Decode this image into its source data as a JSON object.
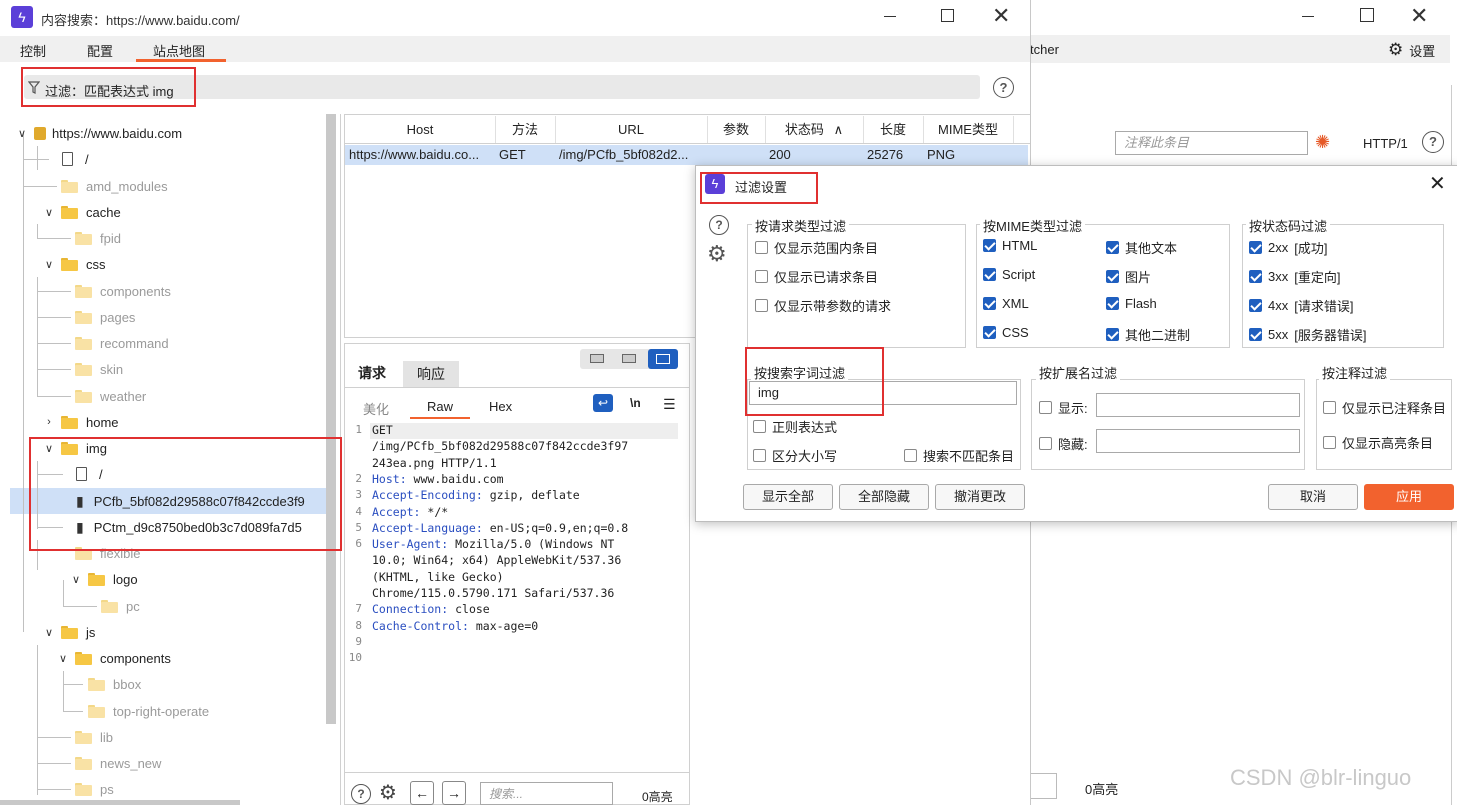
{
  "main_window": {
    "title": "内容搜索：https://www.baidu.com/",
    "tabs": [
      "控制",
      "配置",
      "站点地图"
    ],
    "active_tab": "站点地图",
    "filter_text": "过滤：匹配表达式 img"
  },
  "tree": [
    {
      "label": "https://www.baidu.com",
      "type": "lock"
    },
    {
      "label": "/",
      "type": "file"
    },
    {
      "label": "amd_modules",
      "type": "folder"
    },
    {
      "label": "cache",
      "type": "folder"
    },
    {
      "label": "fpid",
      "type": "folder"
    },
    {
      "label": "css",
      "type": "folder"
    },
    {
      "label": "components",
      "type": "folder"
    },
    {
      "label": "pages",
      "type": "folder"
    },
    {
      "label": "recommand",
      "type": "folder"
    },
    {
      "label": "skin",
      "type": "folder"
    },
    {
      "label": "weather",
      "type": "folder"
    },
    {
      "label": "home",
      "type": "folder"
    },
    {
      "label": "img",
      "type": "folder"
    },
    {
      "label": "/",
      "type": "file"
    },
    {
      "label": "PCfb_5bf082d29588c07f842ccde3f9",
      "type": "image"
    },
    {
      "label": "PCtm_d9c8750bed0b3c7d089fa7d5",
      "type": "image"
    },
    {
      "label": "flexible",
      "type": "folder"
    },
    {
      "label": "logo",
      "type": "folder"
    },
    {
      "label": "pc",
      "type": "folder"
    },
    {
      "label": "js",
      "type": "folder"
    },
    {
      "label": "components",
      "type": "folder"
    },
    {
      "label": "bbox",
      "type": "folder"
    },
    {
      "label": "top-right-operate",
      "type": "folder"
    },
    {
      "label": "lib",
      "type": "folder"
    },
    {
      "label": "news_new",
      "type": "folder"
    },
    {
      "label": "ps",
      "type": "folder"
    }
  ],
  "table": {
    "headers": [
      "Host",
      "方法",
      "URL",
      "参数",
      "状态码",
      "长度",
      "MIME类型"
    ],
    "rows": [
      [
        "https://www.baidu.co...",
        "GET",
        "/img/PCfb_5bf082d2...",
        "",
        "200",
        "25276",
        "PNG"
      ]
    ]
  },
  "request_panel": {
    "tabs": [
      "请求",
      "响应"
    ],
    "subtabs": [
      "美化",
      "Raw",
      "Hex"
    ],
    "newline_toggle": "\\n",
    "lines": [
      {
        "n": "1",
        "text": "GET"
      },
      {
        "n": "",
        "text": "/img/PCfb_5bf082d29588c07f842ccde3f97"
      },
      {
        "n": "",
        "text": "243ea.png HTTP/1.1"
      },
      {
        "n": "2",
        "key": "Host:",
        "val": " www.baidu.com"
      },
      {
        "n": "3",
        "key": "Accept-Encoding:",
        "val": " gzip, deflate"
      },
      {
        "n": "4",
        "key": "Accept:",
        "val": " */*"
      },
      {
        "n": "5",
        "key": "Accept-Language:",
        "val": " en-US;q=0.9,en;q=0.8"
      },
      {
        "n": "6",
        "key": "User-Agent:",
        "val": " Mozilla/5.0 (Windows NT"
      },
      {
        "n": "",
        "text": "10.0; Win64; x64) AppleWebKit/537.36"
      },
      {
        "n": "",
        "text": "(KHTML, like Gecko)"
      },
      {
        "n": "",
        "text": "Chrome/115.0.5790.171 Safari/537.36"
      },
      {
        "n": "7",
        "key": "Connection:",
        "val": " close"
      },
      {
        "n": "8",
        "key": "Cache-Control:",
        "val": " max-age=0"
      },
      {
        "n": "9",
        "text": ""
      },
      {
        "n": "10",
        "text": ""
      }
    ],
    "search_placeholder": "搜索...",
    "highlight_count": "0高亮"
  },
  "background_window": {
    "tab_fragment": "tcher",
    "settings_label": "设置",
    "comment_placeholder": "注释此条目",
    "http_version": "HTTP/1",
    "highlight_count": "0高亮",
    "watermark": "CSDN @blr-linguo"
  },
  "dialog": {
    "title": "过滤设置",
    "request_type": {
      "title": "按请求类型过滤",
      "options": [
        {
          "label": "仅显示范围内条目",
          "checked": false
        },
        {
          "label": "仅显示已请求条目",
          "checked": false
        },
        {
          "label": "仅显示带参数的请求",
          "checked": false
        }
      ]
    },
    "mime": {
      "title": "按MIME类型过滤",
      "options": [
        {
          "label": "HTML",
          "checked": true
        },
        {
          "label": "其他文本",
          "checked": true
        },
        {
          "label": "Script",
          "checked": true
        },
        {
          "label": "图片",
          "checked": true
        },
        {
          "label": "XML",
          "checked": true
        },
        {
          "label": "Flash",
          "checked": true
        },
        {
          "label": "CSS",
          "checked": true
        },
        {
          "label": "其他二进制",
          "checked": true
        }
      ]
    },
    "status": {
      "title": "按状态码过滤",
      "options": [
        {
          "code": "2xx",
          "desc": "[成功]",
          "checked": true
        },
        {
          "code": "3xx",
          "desc": "[重定向]",
          "checked": true
        },
        {
          "code": "4xx",
          "desc": "[请求错误]",
          "checked": true
        },
        {
          "code": "5xx",
          "desc": "[服务器错误]",
          "checked": true
        }
      ]
    },
    "search": {
      "title": "按搜索字词过滤",
      "value": "img",
      "regex": "正则表达式",
      "case": "区分大小写",
      "negative": "搜索不匹配条目"
    },
    "extension": {
      "title": "按扩展名过滤",
      "show": "显示:",
      "hide": "隐藏:"
    },
    "annotation": {
      "title": "按注释过滤",
      "commented": "仅显示已注释条目",
      "highlighted": "仅显示高亮条目"
    },
    "buttons": {
      "show_all": "显示全部",
      "hide_all": "全部隐藏",
      "revert": "撤消更改",
      "cancel": "取消",
      "apply": "应用"
    }
  },
  "colors": {
    "accent_orange": "#f2622e",
    "brand_purple": "#5b3fd8",
    "selection_blue": "#cfe0f7",
    "annotation_red": "#e03030",
    "checkbox_blue": "#1f5fbf"
  }
}
